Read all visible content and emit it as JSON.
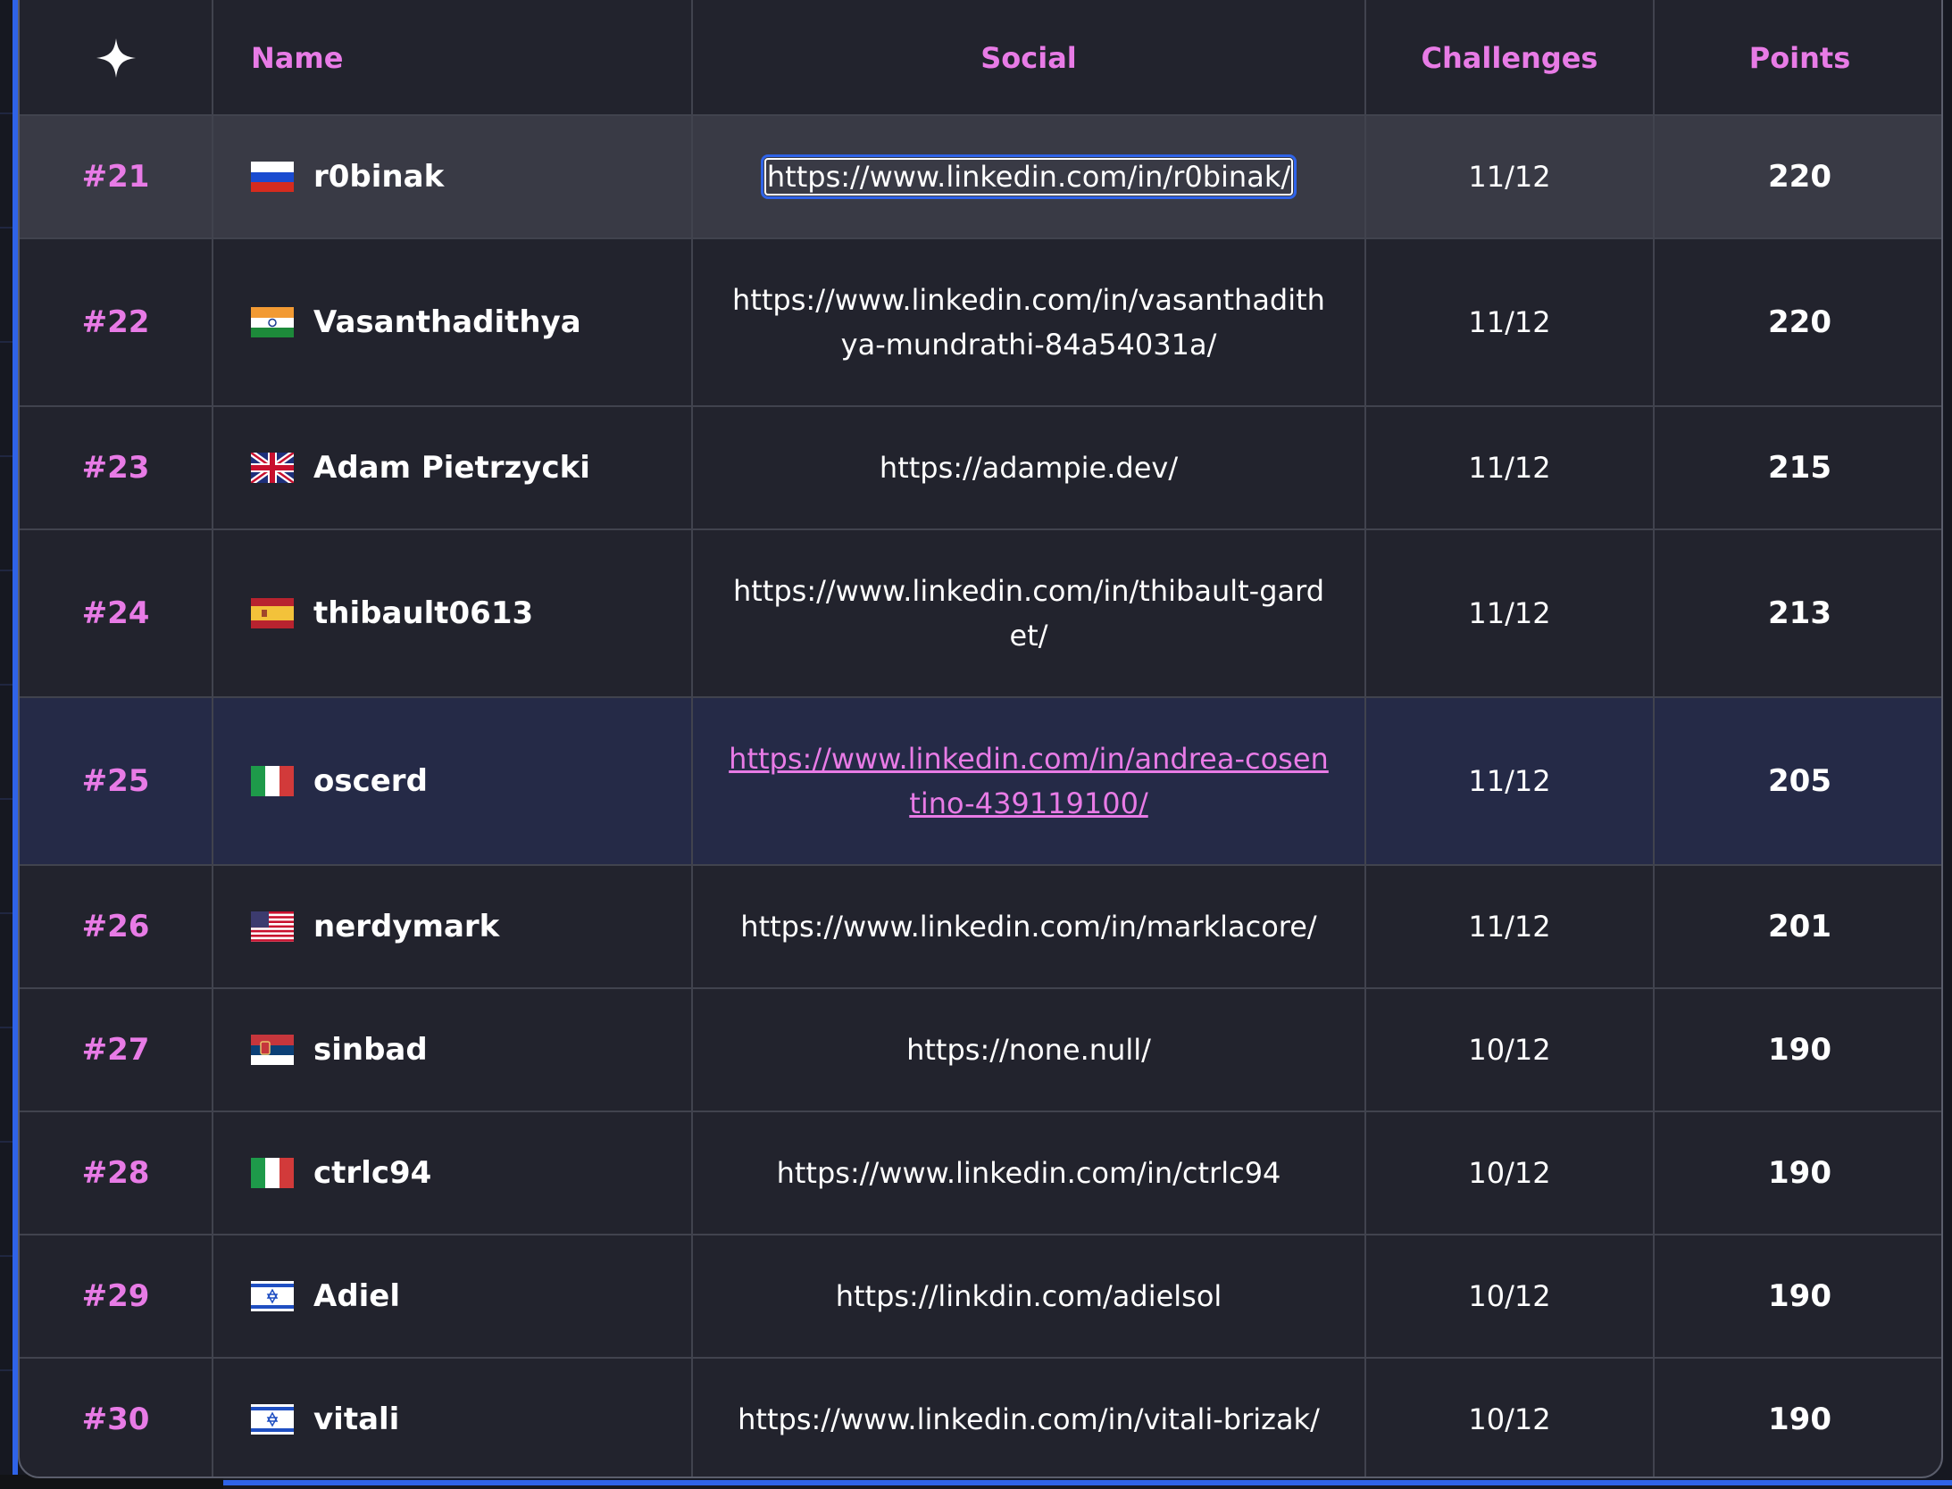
{
  "colors": {
    "accent_pink": "#e87be6",
    "table_bg": "#22232d",
    "row_hover_bg": "#393a45",
    "row_active_bg": "#252a47",
    "focus_blue": "#2f63e8",
    "text": "#ffffff"
  },
  "leaderboard": {
    "header": {
      "rank_icon": "sparkle-icon",
      "name": "Name",
      "social": "Social",
      "challenges": "Challenges",
      "points": "Points"
    },
    "rows": [
      {
        "rank": "#21",
        "flag": "russia-flag-icon",
        "name": "r0binak",
        "social": "https://www.linkedin.com/in/r0binak/",
        "challenges": "11/12",
        "points": "220"
      },
      {
        "rank": "#22",
        "flag": "india-flag-icon",
        "name": "Vasanthadithya",
        "social": "https://www.linkedin.com/in/vasanthadithya-mundrathi-84a54031a/",
        "challenges": "11/12",
        "points": "220"
      },
      {
        "rank": "#23",
        "flag": "uk-flag-icon",
        "name": "Adam Pietrzycki",
        "social": "https://adampie.dev/",
        "challenges": "11/12",
        "points": "215"
      },
      {
        "rank": "#24",
        "flag": "spain-flag-icon",
        "name": "thibault0613",
        "social": "https://www.linkedin.com/in/thibault-gardet/",
        "challenges": "11/12",
        "points": "213"
      },
      {
        "rank": "#25",
        "flag": "italy-flag-icon",
        "name": "oscerd",
        "social": "https://www.linkedin.com/in/andrea-cosentino-439119100/",
        "challenges": "11/12",
        "points": "205"
      },
      {
        "rank": "#26",
        "flag": "usa-flag-icon",
        "name": "nerdymark",
        "social": "https://www.linkedin.com/in/marklacore/",
        "challenges": "11/12",
        "points": "201"
      },
      {
        "rank": "#27",
        "flag": "serbia-flag-icon",
        "name": "sinbad",
        "social": "https://none.null/",
        "challenges": "10/12",
        "points": "190"
      },
      {
        "rank": "#28",
        "flag": "italy-flag-icon",
        "name": "ctrlc94",
        "social": "https://www.linkedin.com/in/ctrlc94",
        "challenges": "10/12",
        "points": "190"
      },
      {
        "rank": "#29",
        "flag": "israel-flag-icon",
        "name": "Adiel",
        "social": "https://linkdin.com/adielsol",
        "challenges": "10/12",
        "points": "190"
      },
      {
        "rank": "#30",
        "flag": "israel-flag-icon",
        "name": "vitali",
        "social": "https://www.linkedin.com/in/vitali-brizak/",
        "challenges": "10/12",
        "points": "190"
      }
    ]
  }
}
